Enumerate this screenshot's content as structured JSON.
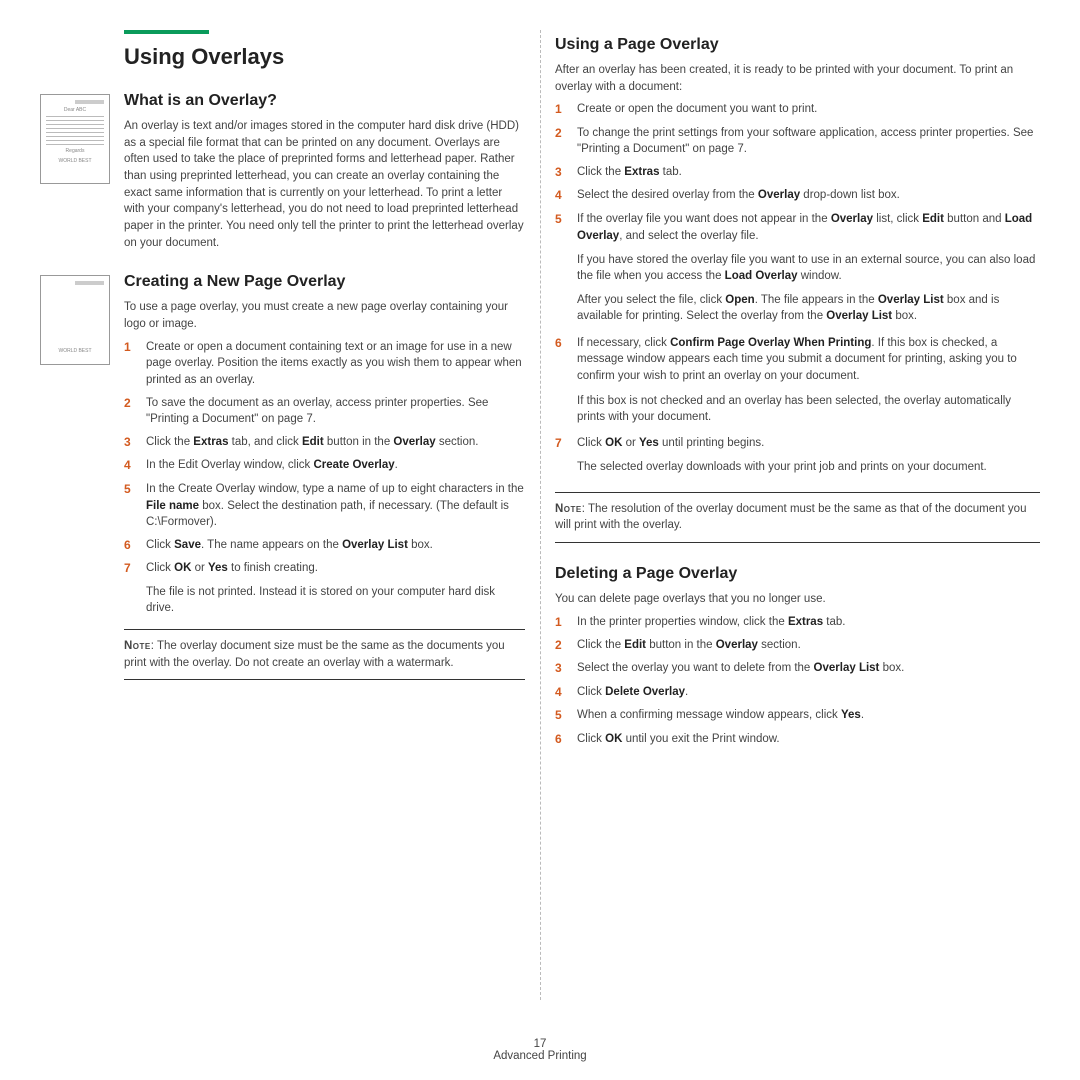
{
  "header": {
    "title": "Using Overlays"
  },
  "s1": {
    "heading": "What is an Overlay?",
    "body": "An overlay is text and/or images stored in the computer hard disk drive (HDD) as a special file format that can be printed on any document. Overlays are often used to take the place of preprinted forms and letterhead paper. Rather than using preprinted letterhead, you can create an overlay containing the exact same information that is currently on your letterhead. To print a letter with your company's letterhead, you do not need to load preprinted letterhead paper in the printer. You need only tell the printer to print the letterhead overlay on your document.",
    "icon_dear": "Dear ABC",
    "icon_regards": "Regards",
    "icon_wb": "WORLD BEST"
  },
  "s2": {
    "heading": "Creating a New Page Overlay",
    "intro": "To use a page overlay, you must create a new page overlay containing your logo or image.",
    "icon_wb": "WORLD BEST",
    "steps": {
      "1": "Create or open a document containing text or an image for use in a new page overlay. Position the items exactly as you wish them to appear when printed as an overlay.",
      "2": "To save the document as an overlay, access printer properties. See \"Printing a Document\" on page 7.",
      "7_after": "The file is not printed. Instead it is stored on your computer hard disk drive."
    },
    "note": ": The overlay document size must be the same as the documents you print with the overlay. Do not create an overlay with a watermark.",
    "note_label": "Note"
  },
  "s3": {
    "heading": "Using a Page Overlay",
    "intro": "After an overlay has been created, it is ready to be printed with your document. To print an overlay with a document:",
    "steps": {
      "1": "Create or open the document you want to print.",
      "2": "To change the print settings from your software application, access printer properties. See \"Printing a Document\" on page 7.",
      "5_p2": "If you have stored the overlay file you want to use in an external source, you can also load the file when you access the ",
      "5_p2b": " window.",
      "6_p2": "If this box is not checked and an overlay has been selected, the overlay automatically prints with your document.",
      "7_p2": "The selected overlay downloads with your print job and prints on your document."
    },
    "note": ": The resolution of the overlay document must be the same as that of the document you will print with the overlay.",
    "note_label": "Note"
  },
  "s4": {
    "heading": "Deleting a Page Overlay",
    "intro": "You can delete page overlays that you no longer use."
  },
  "bold": {
    "extras": "Extras",
    "edit": "Edit",
    "overlay": "Overlay",
    "create_overlay": "Create Overlay",
    "file_name": "File name",
    "save": "Save",
    "overlay_list": "Overlay List",
    "ok": "OK",
    "yes": "Yes",
    "load_overlay": "Load Overlay",
    "open": "Open",
    "confirm": "Confirm Page Overlay When Printing",
    "delete_overlay": "Delete Overlay",
    "list": "List"
  },
  "footer": {
    "page": "17",
    "section": "Advanced Printing"
  }
}
